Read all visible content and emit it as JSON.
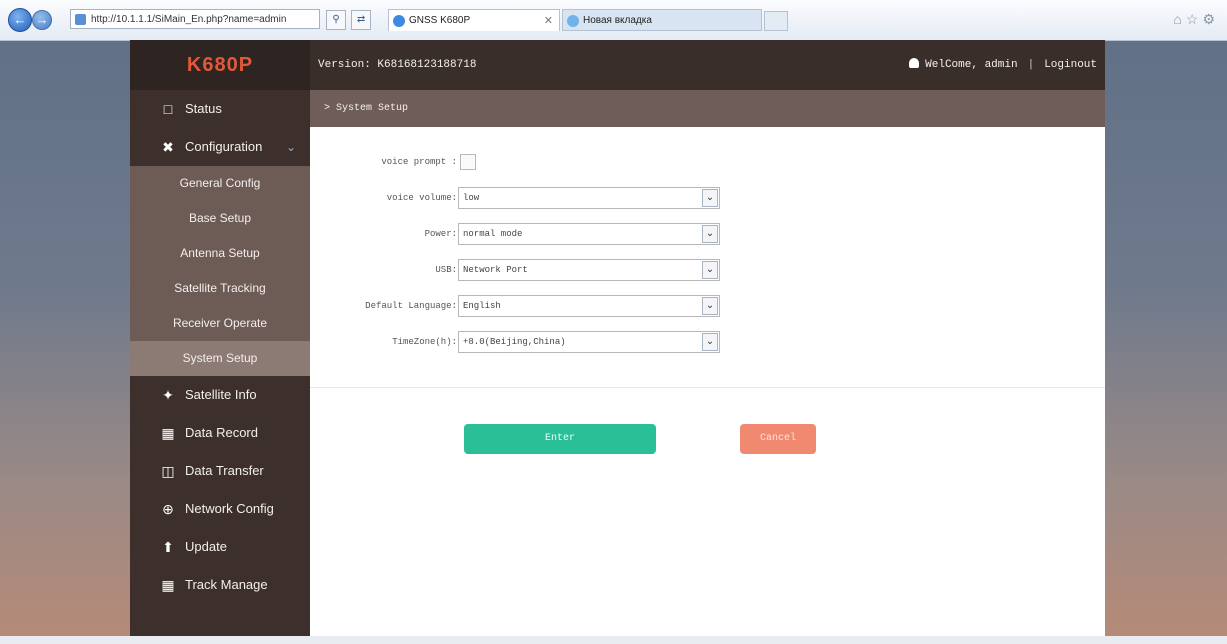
{
  "browser": {
    "address": "http://10.1.1.1/SiMain_En.php?name=admin",
    "tab_active": "GNSS K680P",
    "tab_inactive": "Новая вкладка"
  },
  "sidebar": {
    "logo": "K680P",
    "items": [
      {
        "label": "Status",
        "icon": "monitor-icon"
      },
      {
        "label": "Configuration",
        "icon": "tools-icon",
        "expanded": true
      }
    ],
    "sub_items": [
      {
        "label": "General Config"
      },
      {
        "label": "Base Setup"
      },
      {
        "label": "Antenna Setup"
      },
      {
        "label": "Satellite Tracking"
      },
      {
        "label": "Receiver Operate"
      },
      {
        "label": "System Setup",
        "active": true
      }
    ],
    "items_after": [
      {
        "label": "Satellite Info",
        "icon": "satellite-icon"
      },
      {
        "label": "Data Record",
        "icon": "calendar-icon"
      },
      {
        "label": "Data Transfer",
        "icon": "network-icon"
      },
      {
        "label": "Network Config",
        "icon": "globe-icon"
      },
      {
        "label": "Update",
        "icon": "upload-icon"
      },
      {
        "label": "Track Manage",
        "icon": "calendar-icon"
      }
    ]
  },
  "header": {
    "version": "Version: K68168123188718",
    "welcome": "WelCome, admin",
    "logout": "Loginout"
  },
  "page": {
    "breadcrumb": "> System Setup"
  },
  "form": {
    "voice_prompt_label": "voice prompt :",
    "voice_volume_label": "voice volume:",
    "voice_volume_value": "low",
    "power_label": "Power:",
    "power_value": "normal mode",
    "usb_label": "USB:",
    "usb_value": "Network Port",
    "language_label": "Default Language:",
    "language_value": "English",
    "timezone_label": "TimeZone(h):",
    "timezone_value": "+8.0(Beijing,China)",
    "enter_label": "Enter",
    "cancel_label": "Cancel"
  }
}
